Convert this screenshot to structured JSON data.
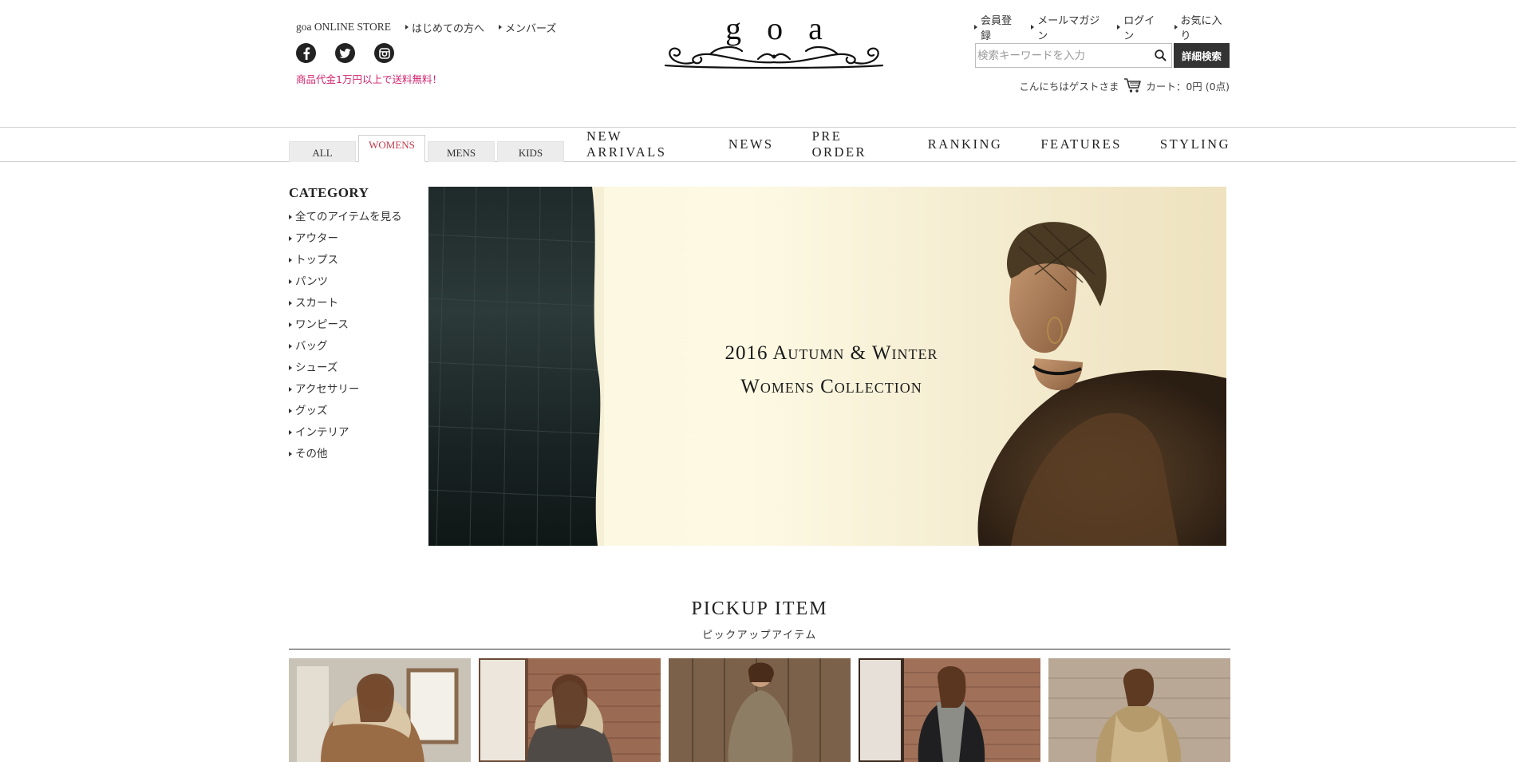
{
  "header": {
    "store_label": "goa ONLINE STORE",
    "left_links": [
      "はじめての方へ",
      "メンバーズ"
    ],
    "social": [
      {
        "icon": "facebook-icon"
      },
      {
        "icon": "twitter-icon"
      },
      {
        "icon": "instagram-icon"
      }
    ],
    "free_shipping": "商品代金1万円以上で送料無料！",
    "logo": "goa",
    "user_links": [
      "会員登録",
      "メールマガジン",
      "ログイン",
      "お気に入り"
    ],
    "search": {
      "placeholder": "検索キーワードを入力",
      "button": "詳細検索"
    },
    "greeting": "こんにちはゲストさま",
    "cart": "カート：0円 (0点)"
  },
  "nav": {
    "gender_tabs": [
      {
        "label": "ALL",
        "active": false
      },
      {
        "label": "WOMENS",
        "active": true
      },
      {
        "label": "MENS",
        "active": false
      },
      {
        "label": "KIDS",
        "active": false
      }
    ],
    "main_links": [
      "NEW ARRIVALS",
      "NEWS",
      "PRE ORDER",
      "RANKING",
      "FEATURES",
      "STYLING"
    ]
  },
  "sidebar": {
    "title": "CATEGORY",
    "items": [
      "全てのアイテムを見る",
      "アウター",
      "トップス",
      "パンツ",
      "スカート",
      "ワンピース",
      "バッグ",
      "シューズ",
      "アクセサリー",
      "グッズ",
      "インテリア",
      "その他"
    ]
  },
  "hero": {
    "line1": "2016 Autumn & Winter",
    "line2": "Womens Collection"
  },
  "pickup": {
    "title": "PICKUP ITEM",
    "subtitle": "ピックアップアイテム"
  },
  "colors": {
    "accent_pink": "#d3246f",
    "active_tab_red": "#c5384a",
    "dark": "#333333"
  }
}
